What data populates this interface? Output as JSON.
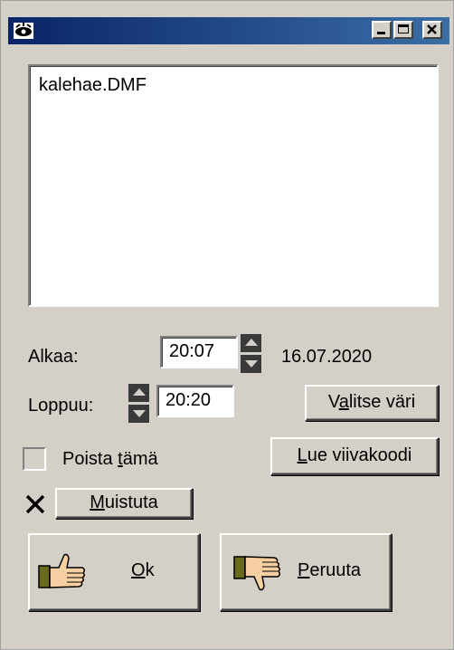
{
  "memo": {
    "lines": [
      "kalehae.DMF"
    ]
  },
  "start": {
    "label": "Alkaa:",
    "time": "20:07",
    "date": "16.07.2020"
  },
  "end": {
    "label": "Loppuu:",
    "time": "20:20"
  },
  "buttons": {
    "choose_color": {
      "pre": "V",
      "u": "a",
      "post": "litse väri"
    },
    "read_barcode": {
      "pre": "",
      "u": "L",
      "post": "ue viivakoodi"
    },
    "remind": {
      "pre": "",
      "u": "M",
      "post": "uistuta"
    },
    "ok": {
      "pre": "",
      "u": "O",
      "post": "k"
    },
    "cancel": {
      "pre": "",
      "u": "P",
      "post": "eruuta"
    }
  },
  "delete_this": {
    "pre": "Poista ",
    "u": "t",
    "post": "ämä",
    "checked": false
  },
  "remind_checked": true,
  "colors": {
    "titlebar_start": "#0a246a",
    "titlebar_end": "#3a6ea5",
    "face": "#d4d0c8"
  }
}
